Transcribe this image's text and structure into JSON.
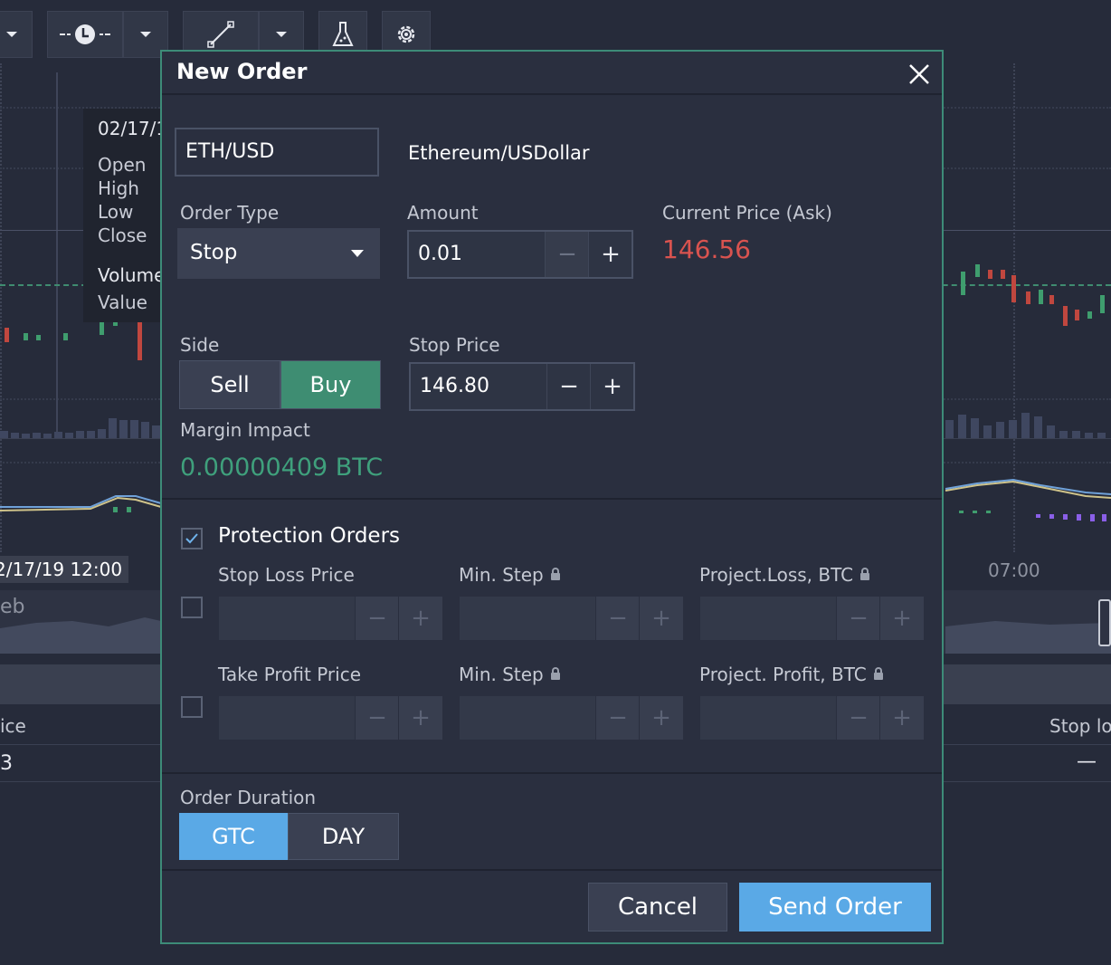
{
  "background": {
    "tooltip": {
      "date": "02/17/1",
      "labels": [
        "Open",
        "High",
        "Low",
        "Close",
        "Volume",
        "Value"
      ]
    },
    "date_label": "2/17/19 12:00",
    "time_label": "07:00",
    "nav_label": "eb",
    "table_header_left": "ice",
    "table_header_right": "Stop los",
    "table_value_left": "3",
    "table_value_right": "—"
  },
  "dialog": {
    "title": "New Order",
    "symbol": {
      "value": "ETH/USD",
      "description": "Ethereum/USDollar"
    },
    "order_type": {
      "label": "Order Type",
      "value": "Stop"
    },
    "amount": {
      "label": "Amount",
      "value": "0.01"
    },
    "current_price": {
      "label": "Current Price (Ask)",
      "value": "146.56"
    },
    "side": {
      "label": "Side",
      "sell": "Sell",
      "buy": "Buy"
    },
    "stop_price": {
      "label": "Stop Price",
      "value": "146.80"
    },
    "margin_impact": {
      "label": "Margin Impact",
      "value": "0.00000409 BTC"
    },
    "protection": {
      "label": "Protection Orders",
      "stop_loss": {
        "label": "Stop Loss Price",
        "min_step": "Min. Step",
        "projected": "Project.Loss, BTC"
      },
      "take_profit": {
        "label": "Take Profit Price",
        "min_step": "Min. Step",
        "projected": "Project. Profit, BTC"
      }
    },
    "duration": {
      "label": "Order Duration",
      "gtc": "GTC",
      "day": "DAY"
    },
    "buttons": {
      "cancel": "Cancel",
      "send": "Send Order"
    },
    "minus": "−",
    "plus": "+"
  },
  "colors": {
    "accent_green": "#3e8d72",
    "price_red": "#d9534f",
    "margin_green": "#3fa07c",
    "primary_blue": "#5aa9e6"
  },
  "icons": [
    "chevron-down-icon",
    "clock-icon",
    "line-tool-icon",
    "flask-icon",
    "gear-icon",
    "close-icon",
    "check-icon",
    "lock-icon"
  ]
}
